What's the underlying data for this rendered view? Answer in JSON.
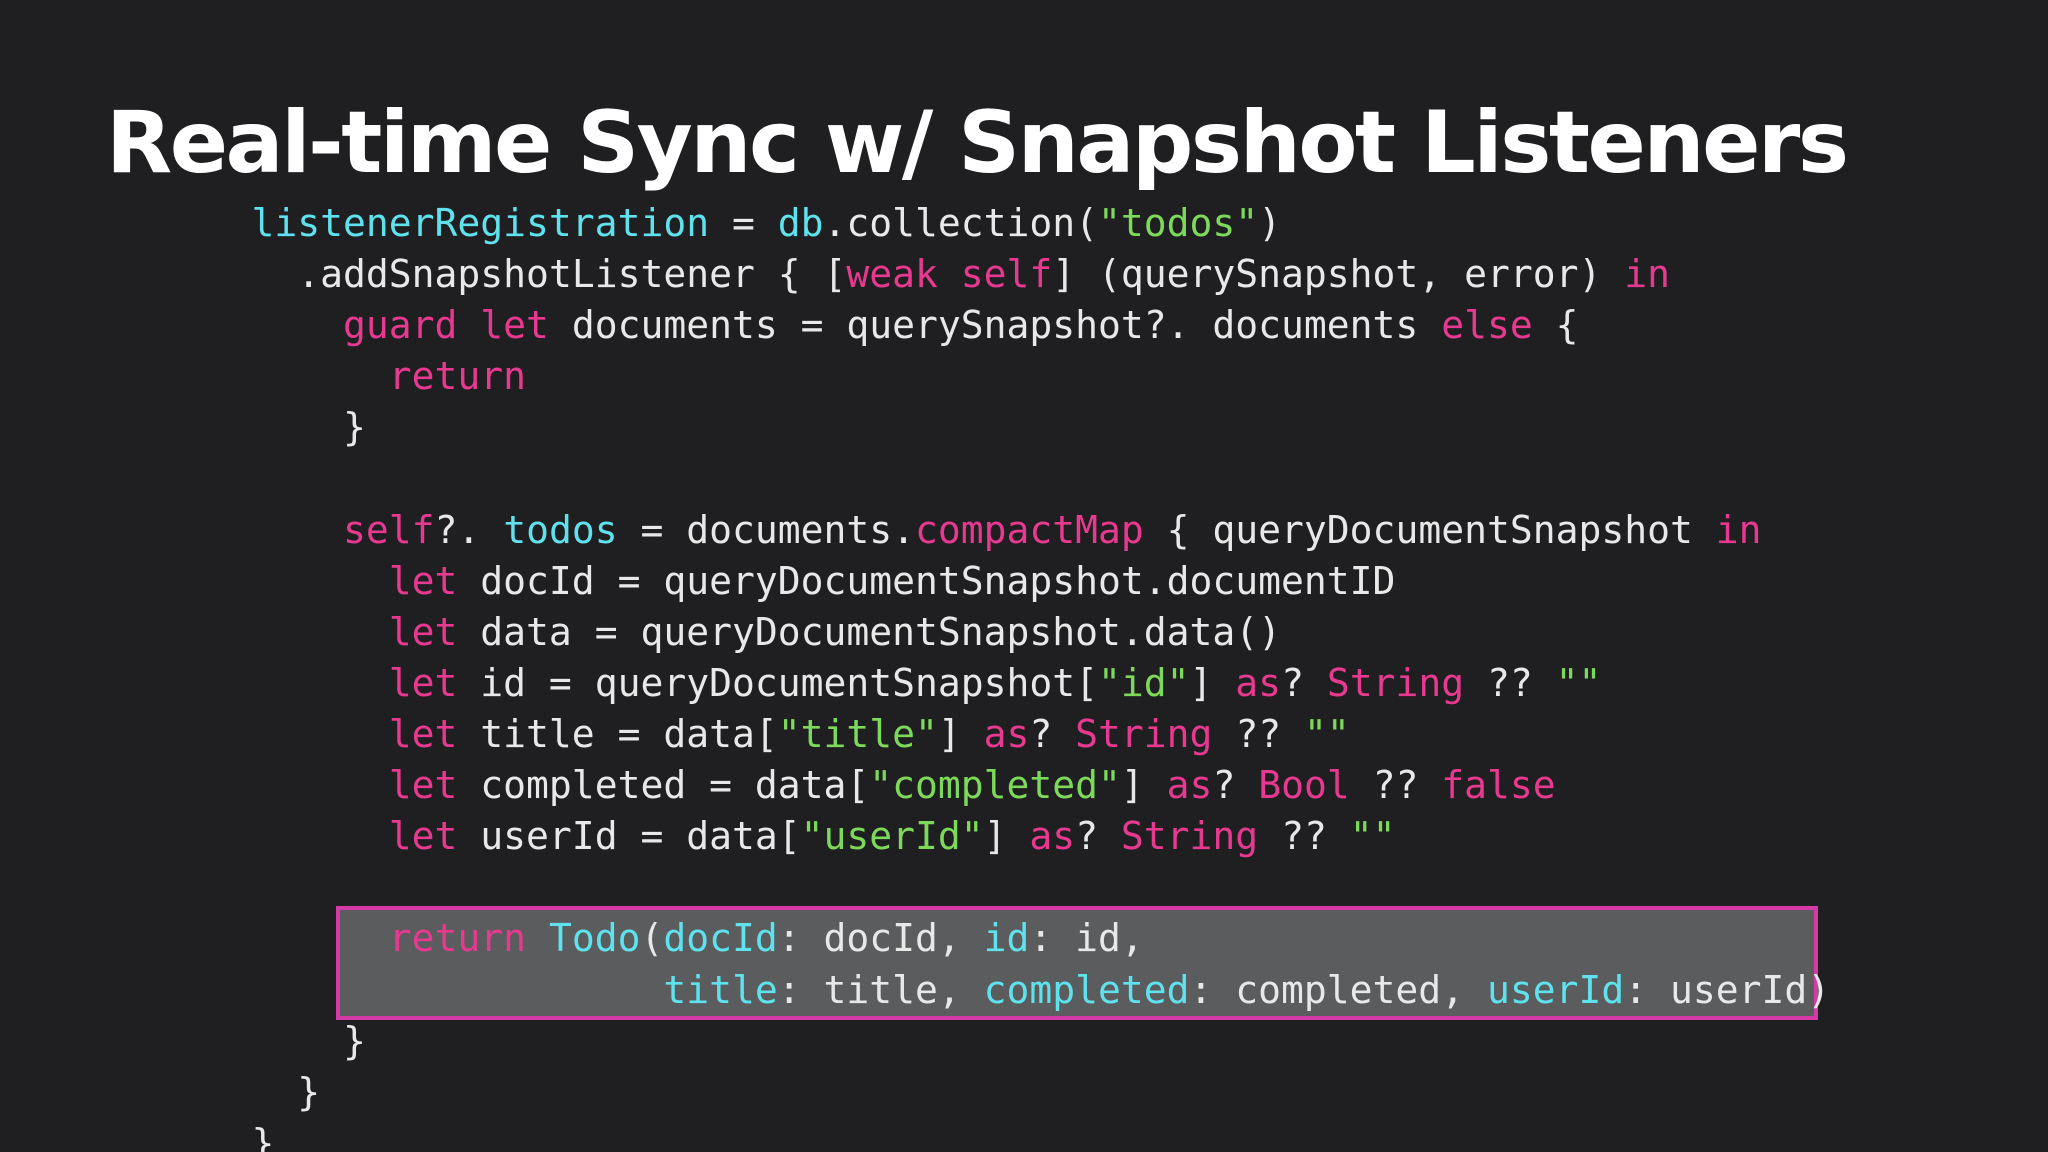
{
  "slide": {
    "title": "Real-time Sync w/ Snapshot Listeners"
  },
  "colors": {
    "background": "#1f1f21",
    "keyword": "#e6398f",
    "identifier": "#5fe2ee",
    "string": "#7dd95a",
    "plain": "#e8e8e8",
    "highlight_fill": "#5a5c5d",
    "highlight_border": "#d63aa6"
  },
  "code": [
    {
      "indent": "    ",
      "tokens": [
        {
          "t": "listenerRegistration",
          "c": "var"
        },
        {
          "t": " = ",
          "c": "pl"
        },
        {
          "t": "db",
          "c": "var"
        },
        {
          "t": ".collection(",
          "c": "pl"
        },
        {
          "t": "\"todos\"",
          "c": "str"
        },
        {
          "t": ")",
          "c": "pl"
        }
      ]
    },
    {
      "indent": "      ",
      "tokens": [
        {
          "t": ".addSnapshotListener { [",
          "c": "pl"
        },
        {
          "t": "weak self",
          "c": "kw"
        },
        {
          "t": "] (querySnapshot, error) ",
          "c": "pl"
        },
        {
          "t": "in",
          "c": "kw"
        }
      ]
    },
    {
      "indent": "        ",
      "tokens": [
        {
          "t": "guard let",
          "c": "kw"
        },
        {
          "t": " documents = querySnapshot?. documents ",
          "c": "pl"
        },
        {
          "t": "else",
          "c": "kw"
        },
        {
          "t": " {",
          "c": "pl"
        }
      ]
    },
    {
      "indent": "          ",
      "tokens": [
        {
          "t": "return",
          "c": "kw"
        }
      ]
    },
    {
      "indent": "        ",
      "tokens": [
        {
          "t": "}",
          "c": "pl"
        }
      ]
    },
    {
      "indent": "",
      "tokens": []
    },
    {
      "indent": "        ",
      "tokens": [
        {
          "t": "self",
          "c": "kw"
        },
        {
          "t": "?. ",
          "c": "pl"
        },
        {
          "t": "todos",
          "c": "var"
        },
        {
          "t": " = documents.",
          "c": "pl"
        },
        {
          "t": "compactMap",
          "c": "kw"
        },
        {
          "t": " { queryDocumentSnapshot ",
          "c": "pl"
        },
        {
          "t": "in",
          "c": "kw"
        }
      ]
    },
    {
      "indent": "          ",
      "tokens": [
        {
          "t": "let",
          "c": "kw"
        },
        {
          "t": " docId = queryDocumentSnapshot.documentID",
          "c": "pl"
        }
      ]
    },
    {
      "indent": "          ",
      "tokens": [
        {
          "t": "let",
          "c": "kw"
        },
        {
          "t": " data = queryDocumentSnapshot.data()",
          "c": "pl"
        }
      ]
    },
    {
      "indent": "          ",
      "tokens": [
        {
          "t": "let",
          "c": "kw"
        },
        {
          "t": " id = queryDocumentSnapshot[",
          "c": "pl"
        },
        {
          "t": "\"id\"",
          "c": "str"
        },
        {
          "t": "] ",
          "c": "pl"
        },
        {
          "t": "as",
          "c": "kw"
        },
        {
          "t": "? ",
          "c": "pl"
        },
        {
          "t": "String",
          "c": "kw"
        },
        {
          "t": " ?? ",
          "c": "pl"
        },
        {
          "t": "\"\"",
          "c": "str"
        }
      ]
    },
    {
      "indent": "          ",
      "tokens": [
        {
          "t": "let",
          "c": "kw"
        },
        {
          "t": " title = data[",
          "c": "pl"
        },
        {
          "t": "\"title\"",
          "c": "str"
        },
        {
          "t": "] ",
          "c": "pl"
        },
        {
          "t": "as",
          "c": "kw"
        },
        {
          "t": "? ",
          "c": "pl"
        },
        {
          "t": "String",
          "c": "kw"
        },
        {
          "t": " ?? ",
          "c": "pl"
        },
        {
          "t": "\"\"",
          "c": "str"
        }
      ]
    },
    {
      "indent": "          ",
      "tokens": [
        {
          "t": "let",
          "c": "kw"
        },
        {
          "t": " completed = data[",
          "c": "pl"
        },
        {
          "t": "\"completed\"",
          "c": "str"
        },
        {
          "t": "] ",
          "c": "pl"
        },
        {
          "t": "as",
          "c": "kw"
        },
        {
          "t": "? ",
          "c": "pl"
        },
        {
          "t": "Bool",
          "c": "kw"
        },
        {
          "t": " ?? ",
          "c": "pl"
        },
        {
          "t": "false",
          "c": "kw"
        }
      ]
    },
    {
      "indent": "          ",
      "tokens": [
        {
          "t": "let",
          "c": "kw"
        },
        {
          "t": " userId = data[",
          "c": "pl"
        },
        {
          "t": "\"userId\"",
          "c": "str"
        },
        {
          "t": "] ",
          "c": "pl"
        },
        {
          "t": "as",
          "c": "kw"
        },
        {
          "t": "? ",
          "c": "pl"
        },
        {
          "t": "String",
          "c": "kw"
        },
        {
          "t": " ?? ",
          "c": "pl"
        },
        {
          "t": "\"\"",
          "c": "str"
        }
      ]
    },
    {
      "indent": "",
      "tokens": []
    },
    {
      "indent": "          ",
      "highlight": true,
      "tokens": [
        {
          "t": "return",
          "c": "kw"
        },
        {
          "t": " ",
          "c": "pl"
        },
        {
          "t": "Todo",
          "c": "var"
        },
        {
          "t": "(",
          "c": "pl"
        },
        {
          "t": "docId",
          "c": "var"
        },
        {
          "t": ": docId, ",
          "c": "pl"
        },
        {
          "t": "id",
          "c": "var"
        },
        {
          "t": ": id,",
          "c": "pl"
        }
      ]
    },
    {
      "indent": "                      ",
      "highlight": true,
      "tokens": [
        {
          "t": "title",
          "c": "var"
        },
        {
          "t": ": title, ",
          "c": "pl"
        },
        {
          "t": "completed",
          "c": "var"
        },
        {
          "t": ": completed, ",
          "c": "pl"
        },
        {
          "t": "userId",
          "c": "var"
        },
        {
          "t": ": userId)",
          "c": "pl"
        }
      ]
    },
    {
      "indent": "        ",
      "tokens": [
        {
          "t": "}",
          "c": "pl"
        }
      ]
    },
    {
      "indent": "      ",
      "tokens": [
        {
          "t": "}",
          "c": "pl"
        }
      ]
    },
    {
      "indent": "    ",
      "tokens": [
        {
          "t": "}",
          "c": "pl"
        }
      ]
    }
  ]
}
